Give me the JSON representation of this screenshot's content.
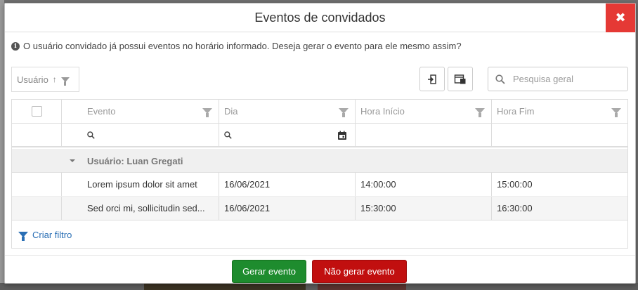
{
  "modal": {
    "title": "Eventos de convidados",
    "close_label": "✖",
    "info_message": "O usuário convidado já possui eventos no horário informado. Deseja gerar o evento para ele mesmo assim?"
  },
  "toolbar": {
    "group_by_label": "Usuário",
    "search_placeholder": "Pesquisa geral"
  },
  "grid": {
    "columns": [
      "Evento",
      "Dia",
      "Hora Início",
      "Hora Fim"
    ],
    "group": {
      "label": "Usuário: Luan Gregati"
    },
    "rows": [
      {
        "evento": "Lorem ipsum dolor sit amet",
        "dia": "16/06/2021",
        "hora_inicio": "14:00:00",
        "hora_fim": "15:00:00"
      },
      {
        "evento": "Sed orci mi, sollicitudin sed...",
        "dia": "16/06/2021",
        "hora_inicio": "15:30:00",
        "hora_fim": "16:30:00"
      }
    ],
    "create_filter_label": "Criar filtro"
  },
  "footer": {
    "confirm_label": "Gerar evento",
    "cancel_label": "Não gerar evento"
  },
  "colors": {
    "confirm": "#1e8c2e",
    "cancel": "#c10f0f",
    "close": "#e53935",
    "link": "#2a6fb5"
  }
}
